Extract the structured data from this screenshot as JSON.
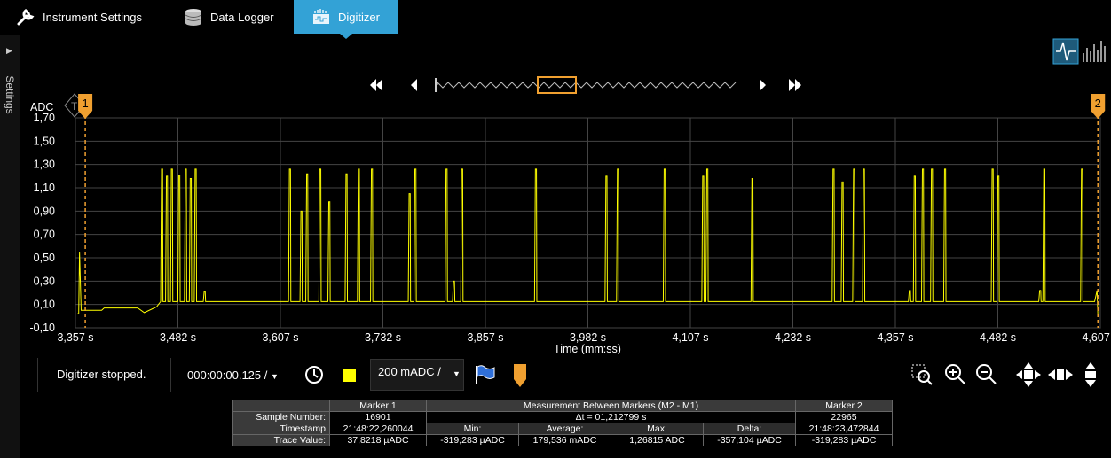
{
  "tabs": [
    {
      "label": "Instrument Settings",
      "icon": "wrench-icon"
    },
    {
      "label": "Data Logger",
      "icon": "database-icon"
    },
    {
      "label": "Digitizer",
      "icon": "digitizer-icon",
      "active": true
    }
  ],
  "side_panel": {
    "label": "Settings"
  },
  "colors": {
    "trace": "#ffff00",
    "accent": "#33a2d6",
    "marker": "#f0a030",
    "grid": "#444444"
  },
  "chart_data": {
    "type": "line",
    "ylabel": "ADC",
    "xlabel": "Time (mm:ss)",
    "y_ticks": [
      "1,70",
      "1,50",
      "1,30",
      "1,10",
      "0,90",
      "0,70",
      "0,50",
      "0,30",
      "0,10",
      "-0,10"
    ],
    "x_ticks": [
      "3,357 s",
      "3,482 s",
      "3,607 s",
      "3,732 s",
      "3,857 s",
      "3,982 s",
      "4,107 s",
      "4,232 s",
      "4,357 s",
      "4,482 s",
      "4,607 s"
    ],
    "xlim": [
      3.357,
      4.607
    ],
    "ylim": [
      -0.1,
      1.7
    ],
    "grid": true,
    "baseline": 0.125,
    "bursts": [
      {
        "t": 3.462,
        "peak": 1.26
      },
      {
        "t": 3.468,
        "peak": 1.2
      },
      {
        "t": 3.474,
        "peak": 1.26
      },
      {
        "t": 3.483,
        "peak": 1.21
      },
      {
        "t": 3.491,
        "peak": 1.26
      },
      {
        "t": 3.497,
        "peak": 1.18
      },
      {
        "t": 3.503,
        "peak": 1.26
      },
      {
        "t": 3.514,
        "peak": 0.21
      },
      {
        "t": 3.618,
        "peak": 1.26
      },
      {
        "t": 3.632,
        "peak": 0.9
      },
      {
        "t": 3.639,
        "peak": 1.22
      },
      {
        "t": 3.655,
        "peak": 1.26
      },
      {
        "t": 3.666,
        "peak": 0.98
      },
      {
        "t": 3.687,
        "peak": 1.22
      },
      {
        "t": 3.702,
        "peak": 1.26
      },
      {
        "t": 3.718,
        "peak": 1.26
      },
      {
        "t": 3.764,
        "peak": 1.05
      },
      {
        "t": 3.771,
        "peak": 1.26
      },
      {
        "t": 3.809,
        "peak": 1.26
      },
      {
        "t": 3.818,
        "peak": 0.3
      },
      {
        "t": 3.828,
        "peak": 1.26
      },
      {
        "t": 3.918,
        "peak": 1.26
      },
      {
        "t": 4.004,
        "peak": 1.2
      },
      {
        "t": 4.018,
        "peak": 1.26
      },
      {
        "t": 4.075,
        "peak": 1.26
      },
      {
        "t": 4.122,
        "peak": 1.2
      },
      {
        "t": 4.127,
        "peak": 1.26
      },
      {
        "t": 4.182,
        "peak": 1.18
      },
      {
        "t": 4.281,
        "peak": 1.26
      },
      {
        "t": 4.292,
        "peak": 1.15
      },
      {
        "t": 4.306,
        "peak": 1.26
      },
      {
        "t": 4.318,
        "peak": 1.26
      },
      {
        "t": 4.374,
        "peak": 0.22
      },
      {
        "t": 4.38,
        "peak": 1.2
      },
      {
        "t": 4.39,
        "peak": 1.26
      },
      {
        "t": 4.401,
        "peak": 1.26
      },
      {
        "t": 4.417,
        "peak": 1.26
      },
      {
        "t": 4.475,
        "peak": 1.26
      },
      {
        "t": 4.482,
        "peak": 1.2
      },
      {
        "t": 4.533,
        "peak": 0.22
      },
      {
        "t": 4.538,
        "peak": 1.26
      },
      {
        "t": 4.584,
        "peak": 1.26
      }
    ]
  },
  "markers": [
    {
      "label": "1",
      "t": 3.369
    },
    {
      "label": "2",
      "t": 4.604
    }
  ],
  "trigger_label": "T",
  "status_text": "Digitizer stopped.",
  "timebase_value": "000:00:00.125 /",
  "scale_value": "200 mADC /",
  "measurement": {
    "header_marker1": "Marker 1",
    "header_between": "Measurement Between Markers (M2 - M1)",
    "header_marker2": "Marker 2",
    "row_sample_label": "Sample Number:",
    "row_timestamp_label": "Timestamp",
    "row_trace_label": "Trace Value:",
    "m1_sample": "16901",
    "m2_sample": "22965",
    "delta_t": "Δt = 01,212799 s",
    "m1_timestamp": "21:48:22,260044",
    "m2_timestamp": "21:48:23,472844",
    "min_label": "Min:",
    "avg_label": "Average:",
    "max_label": "Max:",
    "delta_label": "Delta:",
    "m1_value": "37,8218 µADC",
    "min_value": "-319,283 µADC",
    "avg_value": "179,536 mADC",
    "max_value": "1,26815  ADC",
    "delta_value": "-357,104 µADC",
    "m2_value": "-319,283 µADC"
  }
}
